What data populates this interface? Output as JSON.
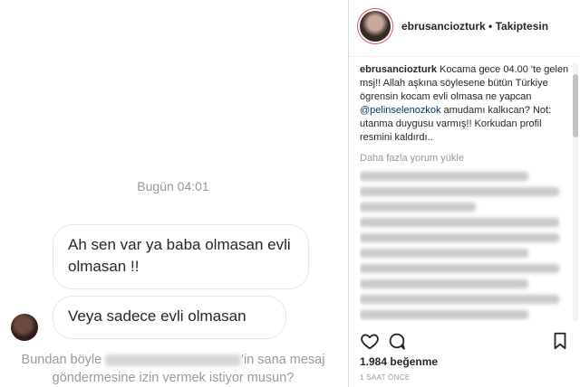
{
  "dm": {
    "timestamp": "Bugün 04:01",
    "messages": [
      "Ah sen var ya baba olmasan evli olmasan !!",
      "Veya sadece evli olmasan"
    ],
    "request_prefix": "Bundan böyle",
    "request_suffix": "'in sana mesaj göndermesine izin vermek istiyor musun?"
  },
  "post": {
    "username": "ebrusanciozturk",
    "follow_status": "• Takiptesin",
    "caption_user": "ebrusanciozturk",
    "caption_part1": "Kocama gece 04.00 'te gelen msj!! Allah aşkına söylesene bütün Türkiye ögrensin kocam evli olmasa ne yapcan",
    "caption_mention": "@pelinselenozkok",
    "caption_part2": "amudamı kalkıcan? Not: utanma duygusu varmış!! Korkudan profil resmini kaldırdı..",
    "more_comments": "Daha fazla yorum yükle",
    "likes": "1.984 beğenme",
    "time_ago": "1 SAAT ÖNCE"
  },
  "colors": {
    "text": "#262626",
    "muted": "#999999",
    "border": "#dbdbdb",
    "mention": "#003569"
  },
  "icons": [
    "heart-icon",
    "comment-icon",
    "bookmark-icon"
  ]
}
